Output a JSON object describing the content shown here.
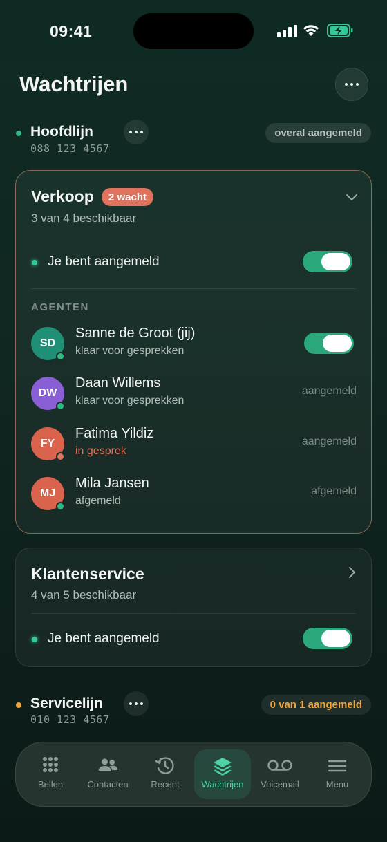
{
  "status_bar": {
    "time": "09:41"
  },
  "header": {
    "title": "Wachtrijen"
  },
  "lines": [
    {
      "name": "Hoofdlijn",
      "number": "088 123 4567",
      "pill": "overal aangemeld",
      "dot_color": "#2fb985"
    },
    {
      "name": "Servicelijn",
      "number": "010 123 4567",
      "pill": "0 van 1 aangemeld",
      "dot_color": "#f2a53a"
    }
  ],
  "queues": [
    {
      "name": "Verkoop",
      "badge": "2 wacht",
      "availability": "3 van 4 beschikbaar",
      "signed_in_label": "Je bent aangemeld",
      "signed_in": true,
      "section_label": "AGENTEN",
      "agents": [
        {
          "initials": "SD",
          "name": "Sanne de Groot (jij)",
          "status": "klaar voor gesprekken",
          "state": "",
          "avatar_color": "#1f8f76",
          "dot_color": "#2fb985",
          "status_color": "#b0bcb7",
          "toggle": true
        },
        {
          "initials": "DW",
          "name": "Daan Willems",
          "status": "klaar voor gesprekken",
          "state": "aangemeld",
          "avatar_color": "#8a5fd6",
          "dot_color": "#2fb985",
          "status_color": "#b0bcb7",
          "toggle": false
        },
        {
          "initials": "FY",
          "name": "Fatima Yildiz",
          "status": "in gesprek",
          "state": "aangemeld",
          "avatar_color": "#d9634d",
          "dot_color": "#e0735d",
          "status_color": "#e0735d",
          "toggle": false
        },
        {
          "initials": "MJ",
          "name": "Mila Jansen",
          "status": "afgemeld",
          "state": "afgemeld",
          "avatar_color": "#d9634d",
          "dot_color": "#2fb985",
          "status_color": "#b0bcb7",
          "toggle": false
        }
      ]
    },
    {
      "name": "Klantenservice",
      "availability": "4 van 5 beschikbaar",
      "signed_in_label": "Je bent aangemeld",
      "signed_in": true
    }
  ],
  "tabs": [
    {
      "label": "Bellen",
      "icon": "keypad-icon"
    },
    {
      "label": "Contacten",
      "icon": "contacts-icon"
    },
    {
      "label": "Recent",
      "icon": "history-icon"
    },
    {
      "label": "Wachtrijen",
      "icon": "layers-icon",
      "active": true
    },
    {
      "label": "Voicemail",
      "icon": "voicemail-icon"
    },
    {
      "label": "Menu",
      "icon": "menu-icon"
    }
  ],
  "colors": {
    "accent": "#34c796",
    "alert": "#e0735d",
    "warning": "#f2a53a"
  }
}
